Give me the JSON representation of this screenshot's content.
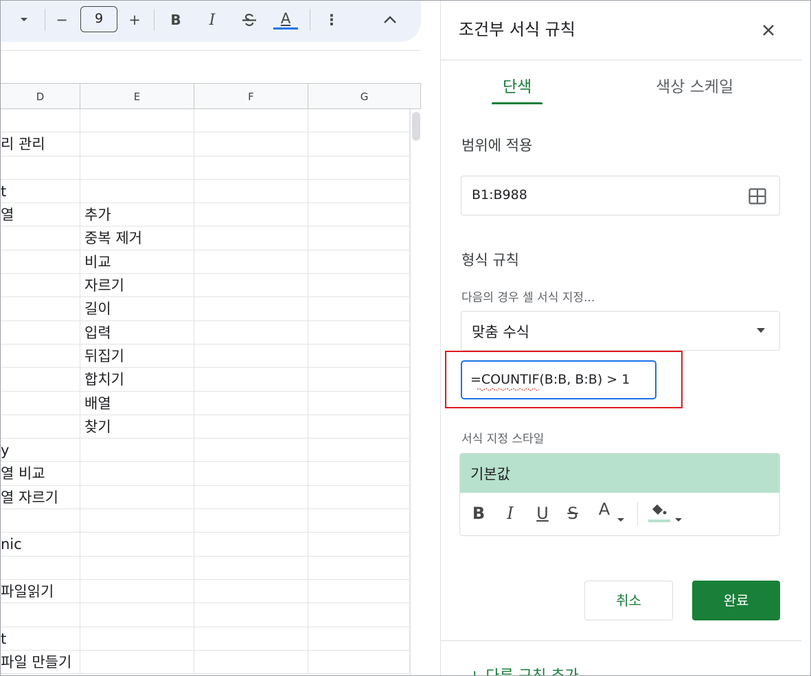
{
  "toolbar": {
    "font_size_value": "9",
    "minus_label": "−",
    "plus_label": "+",
    "bold_label": "B",
    "italic_label": "I",
    "text_color_label": "A",
    "more_label": "⋮",
    "collapse_label": "^",
    "text_color_bar": "#1a73e8"
  },
  "sheet": {
    "columns": [
      "D",
      "E",
      "F",
      "G"
    ],
    "rows": [
      {
        "d": "",
        "e": ""
      },
      {
        "d": "리 관리",
        "e": ""
      },
      {
        "d": "",
        "e": ""
      },
      {
        "d": "t",
        "e": ""
      },
      {
        "d": "열",
        "e": "추가"
      },
      {
        "d": "",
        "e": "중복 제거"
      },
      {
        "d": "",
        "e": "비교"
      },
      {
        "d": "",
        "e": "자르기"
      },
      {
        "d": "",
        "e": "길이"
      },
      {
        "d": "",
        "e": "입력"
      },
      {
        "d": "",
        "e": "뒤집기"
      },
      {
        "d": "",
        "e": "합치기"
      },
      {
        "d": "",
        "e": "배열"
      },
      {
        "d": "",
        "e": "찾기"
      },
      {
        "d": "y",
        "e": ""
      },
      {
        "d": "열 비교",
        "e": ""
      },
      {
        "d": "열 자르기",
        "e": ""
      },
      {
        "d": "",
        "e": ""
      },
      {
        "d": "nic",
        "e": ""
      },
      {
        "d": "",
        "e": ""
      },
      {
        "d": " 파일읽기",
        "e": ""
      },
      {
        "d": "",
        "e": ""
      },
      {
        "d": "t",
        "e": ""
      },
      {
        "d": " 파일 만들기",
        "e": ""
      }
    ]
  },
  "panel": {
    "title": "조건부 서식 규칙",
    "tabs": [
      {
        "label": "단색",
        "active": true
      },
      {
        "label": "색상 스케일",
        "active": false
      }
    ],
    "apply_range": {
      "label": "범위에 적용",
      "value": "B1:B988"
    },
    "format_rules": {
      "label": "형식 규칙",
      "condition_label": "다음의 경우 셀 서식 지정...",
      "condition_value": "맞춤 수식",
      "formula_value": "=COUNTIF(B:B, B:B) > 1"
    },
    "formatting_style": {
      "label": "서식 지정 스타일",
      "preview_text": "기본값",
      "preview_color": "#b7e1cd",
      "tools": {
        "bold": "B",
        "italic": "I",
        "underline": "U",
        "strikethrough": "S",
        "text_color": "A"
      }
    },
    "cancel_label": "취소",
    "done_label": "완료",
    "add_rule_label": "+ 다른 규칙 추가"
  },
  "colors": {
    "accent_green": "#188038",
    "focus_blue": "#1a73e8",
    "highlight_red": "#e0191f"
  }
}
